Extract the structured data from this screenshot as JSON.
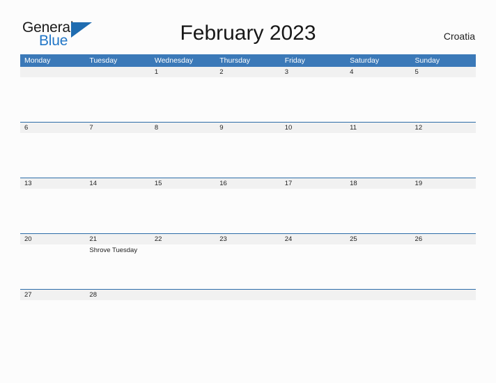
{
  "brand": {
    "name_part1": "General",
    "name_part2": "Blue",
    "triangle_color": "#1f6cb0",
    "blue_color": "#2176c7"
  },
  "header": {
    "title": "February 2023",
    "locale": "Croatia"
  },
  "calendar": {
    "accent_color": "#3b79b8",
    "row_line_color": "#2c6ca8",
    "band_color": "#f1f1f1",
    "weekdays": [
      "Monday",
      "Tuesday",
      "Wednesday",
      "Thursday",
      "Friday",
      "Saturday",
      "Sunday"
    ],
    "weeks": [
      [
        {
          "date": "",
          "events": []
        },
        {
          "date": "",
          "events": []
        },
        {
          "date": "1",
          "events": []
        },
        {
          "date": "2",
          "events": []
        },
        {
          "date": "3",
          "events": []
        },
        {
          "date": "4",
          "events": []
        },
        {
          "date": "5",
          "events": []
        }
      ],
      [
        {
          "date": "6",
          "events": []
        },
        {
          "date": "7",
          "events": []
        },
        {
          "date": "8",
          "events": []
        },
        {
          "date": "9",
          "events": []
        },
        {
          "date": "10",
          "events": []
        },
        {
          "date": "11",
          "events": []
        },
        {
          "date": "12",
          "events": []
        }
      ],
      [
        {
          "date": "13",
          "events": []
        },
        {
          "date": "14",
          "events": []
        },
        {
          "date": "15",
          "events": []
        },
        {
          "date": "16",
          "events": []
        },
        {
          "date": "17",
          "events": []
        },
        {
          "date": "18",
          "events": []
        },
        {
          "date": "19",
          "events": []
        }
      ],
      [
        {
          "date": "20",
          "events": []
        },
        {
          "date": "21",
          "events": [
            "Shrove Tuesday"
          ]
        },
        {
          "date": "22",
          "events": []
        },
        {
          "date": "23",
          "events": []
        },
        {
          "date": "24",
          "events": []
        },
        {
          "date": "25",
          "events": []
        },
        {
          "date": "26",
          "events": []
        }
      ],
      [
        {
          "date": "27",
          "events": []
        },
        {
          "date": "28",
          "events": []
        },
        {
          "date": "",
          "events": []
        },
        {
          "date": "",
          "events": []
        },
        {
          "date": "",
          "events": []
        },
        {
          "date": "",
          "events": []
        },
        {
          "date": "",
          "events": []
        }
      ]
    ]
  }
}
